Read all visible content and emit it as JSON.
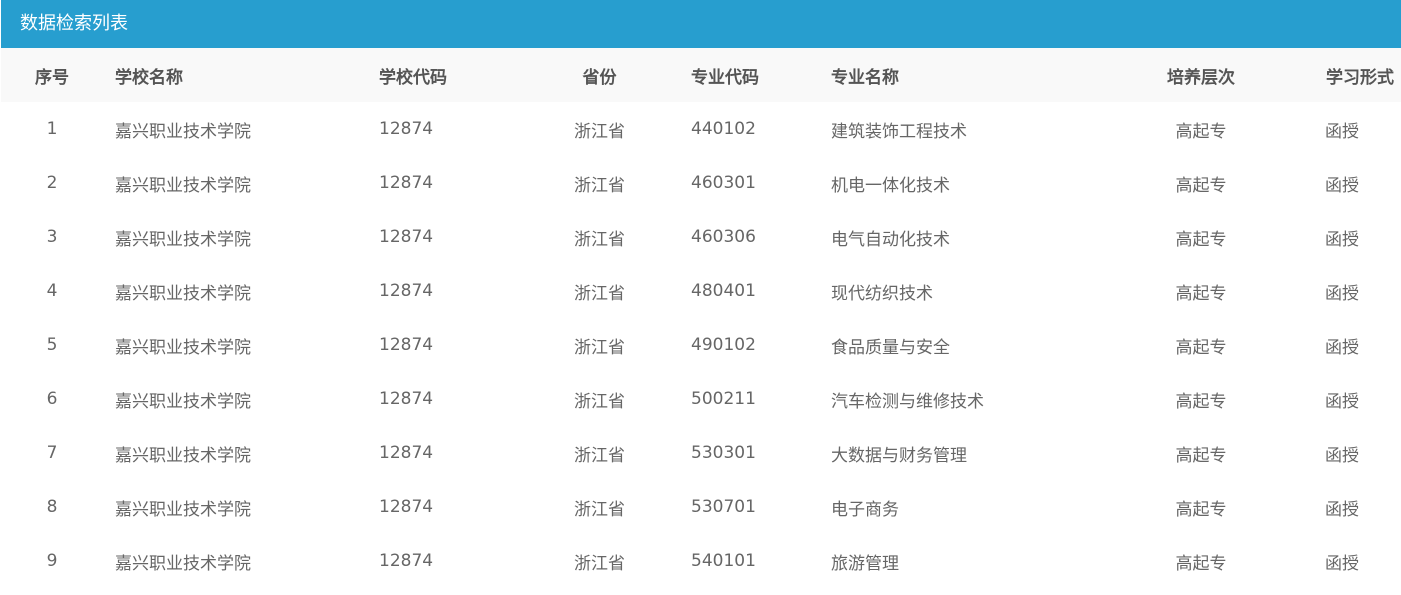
{
  "panel": {
    "title": "数据检索列表"
  },
  "table": {
    "headers": {
      "index": "序号",
      "school_name": "学校名称",
      "school_code": "学校代码",
      "province": "省份",
      "major_code": "专业代码",
      "major_name": "专业名称",
      "level": "培养层次",
      "study_mode": "学习形式"
    },
    "rows": [
      {
        "index": "1",
        "school_name": "嘉兴职业技术学院",
        "school_code": "12874",
        "province": "浙江省",
        "major_code": "440102",
        "major_name": "建筑装饰工程技术",
        "level": "高起专",
        "study_mode": "函授"
      },
      {
        "index": "2",
        "school_name": "嘉兴职业技术学院",
        "school_code": "12874",
        "province": "浙江省",
        "major_code": "460301",
        "major_name": "机电一体化技术",
        "level": "高起专",
        "study_mode": "函授"
      },
      {
        "index": "3",
        "school_name": "嘉兴职业技术学院",
        "school_code": "12874",
        "province": "浙江省",
        "major_code": "460306",
        "major_name": "电气自动化技术",
        "level": "高起专",
        "study_mode": "函授"
      },
      {
        "index": "4",
        "school_name": "嘉兴职业技术学院",
        "school_code": "12874",
        "province": "浙江省",
        "major_code": "480401",
        "major_name": "现代纺织技术",
        "level": "高起专",
        "study_mode": "函授"
      },
      {
        "index": "5",
        "school_name": "嘉兴职业技术学院",
        "school_code": "12874",
        "province": "浙江省",
        "major_code": "490102",
        "major_name": "食品质量与安全",
        "level": "高起专",
        "study_mode": "函授"
      },
      {
        "index": "6",
        "school_name": "嘉兴职业技术学院",
        "school_code": "12874",
        "province": "浙江省",
        "major_code": "500211",
        "major_name": "汽车检测与维修技术",
        "level": "高起专",
        "study_mode": "函授"
      },
      {
        "index": "7",
        "school_name": "嘉兴职业技术学院",
        "school_code": "12874",
        "province": "浙江省",
        "major_code": "530301",
        "major_name": "大数据与财务管理",
        "level": "高起专",
        "study_mode": "函授"
      },
      {
        "index": "8",
        "school_name": "嘉兴职业技术学院",
        "school_code": "12874",
        "province": "浙江省",
        "major_code": "530701",
        "major_name": "电子商务",
        "level": "高起专",
        "study_mode": "函授"
      },
      {
        "index": "9",
        "school_name": "嘉兴职业技术学院",
        "school_code": "12874",
        "province": "浙江省",
        "major_code": "540101",
        "major_name": "旅游管理",
        "level": "高起专",
        "study_mode": "函授"
      }
    ]
  },
  "colors": {
    "header_bar": "#279ecf",
    "table_head_bg": "#f9f9f9"
  }
}
